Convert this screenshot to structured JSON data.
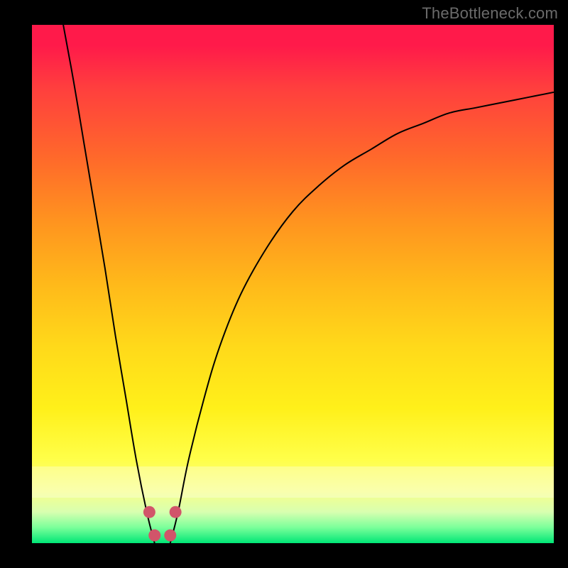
{
  "watermark": {
    "text": "TheBottleneck.com"
  },
  "colors": {
    "curve": "#000000",
    "dots": "#d1556a",
    "dots_outline": "#8c2f3f"
  },
  "chart_data": {
    "type": "line",
    "title": "",
    "xlabel": "",
    "ylabel": "",
    "xlim": [
      0,
      100
    ],
    "ylim": [
      0,
      100
    ],
    "grid": false,
    "legend": false,
    "series": [
      {
        "name": "left-branch",
        "x": [
          6,
          8,
          10,
          12,
          14,
          16,
          18,
          20,
          22,
          23.5
        ],
        "y": [
          100,
          89,
          77,
          65,
          53,
          40,
          28,
          16,
          6,
          0
        ]
      },
      {
        "name": "right-branch",
        "x": [
          26.5,
          28,
          30,
          33,
          36,
          40,
          45,
          50,
          55,
          60,
          65,
          70,
          75,
          80,
          85,
          90,
          95,
          100
        ],
        "y": [
          0,
          6,
          16,
          28,
          38,
          48,
          57,
          64,
          69,
          73,
          76,
          79,
          81,
          83,
          84,
          85,
          86,
          87
        ]
      }
    ],
    "markers": [
      {
        "name": "left-dot-upper",
        "x": 22.5,
        "y": 6
      },
      {
        "name": "left-dot-lower",
        "x": 23.5,
        "y": 1.5
      },
      {
        "name": "right-dot-lower",
        "x": 26.5,
        "y": 1.5
      },
      {
        "name": "right-dot-upper",
        "x": 27.5,
        "y": 6
      }
    ]
  }
}
